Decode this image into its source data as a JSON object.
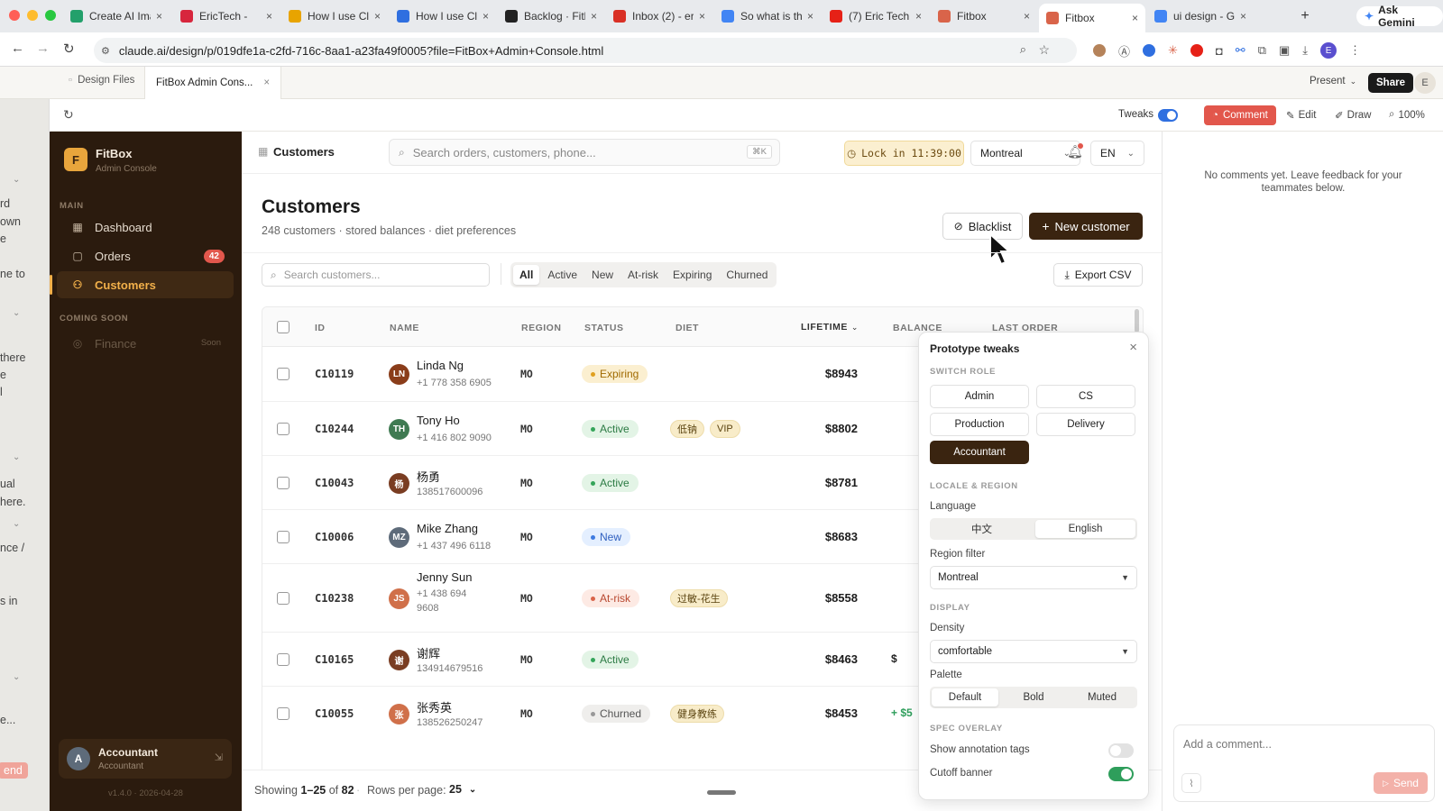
{
  "browser": {
    "tabs": [
      {
        "label": "Create AI Ima",
        "fav": "#23a06b"
      },
      {
        "label": "EricTech - ",
        "fav": "#d7263d"
      },
      {
        "label": "How I use Cla",
        "fav": "#e8a400"
      },
      {
        "label": "How I use Cla",
        "fav": "#2f6fe0"
      },
      {
        "label": "Backlog · Fith",
        "fav": "#222222"
      },
      {
        "label": "Inbox (2) - er",
        "fav": "#d93025"
      },
      {
        "label": "So what is thi",
        "fav": "#4285f4"
      },
      {
        "label": "(7) Eric Tech",
        "fav": "#e62117"
      },
      {
        "label": "Fitbox",
        "fav": "#d9644a"
      },
      {
        "label": "Fitbox",
        "fav": "#d9644a"
      },
      {
        "label": "ui design - G",
        "fav": "#4285f4"
      }
    ],
    "gemini": "Ask Gemini",
    "url": "claude.ai/design/p/019dfe1a-c2fd-716c-8aa1-a23fa49f0005?file=FitBox+Admin+Console.html",
    "profile_initial": "E"
  },
  "appbar": {
    "tab1": "Design Files",
    "tab2": "FitBox Admin Cons...",
    "present": "Present",
    "share": "Share",
    "avatar": "E"
  },
  "toolbar": {
    "tweaks": "Tweaks",
    "comment": "Comment",
    "edit": "Edit",
    "draw": "Draw",
    "zoom": "100%"
  },
  "leftstrip": [
    "rd",
    "own",
    "e",
    "ne to",
    "there",
    "e",
    "l",
    "ual",
    "here.",
    "nce /",
    "s in",
    "e...",
    "end"
  ],
  "sidebar": {
    "logo": "F",
    "brand": "FitBox",
    "brand_sub": "Admin Console",
    "section_main": "MAIN",
    "items": [
      {
        "label": "Dashboard",
        "icon": "grid-icon"
      },
      {
        "label": "Orders",
        "icon": "bag-icon",
        "badge": "42"
      },
      {
        "label": "Customers",
        "icon": "users-icon"
      }
    ],
    "section_soon": "COMING SOON",
    "finance": "Finance",
    "finance_badge": "Soon",
    "user_initial": "A",
    "user_name": "Accountant",
    "user_role": "Accountant",
    "version": "v1.4.0 · 2026-04-28"
  },
  "header": {
    "crumb": "Customers",
    "search_placeholder": "Search orders, customers, phone...",
    "shortcut": "⌘K",
    "lock": "Lock in 11:39:00",
    "city": "Montreal",
    "lang": "EN"
  },
  "page": {
    "title": "Customers",
    "subtitle": "248 customers · stored balances · diet preferences",
    "blacklist": "Blacklist",
    "new_customer": "New customer",
    "search_placeholder": "Search customers...",
    "filters": [
      "All",
      "Active",
      "New",
      "At-risk",
      "Expiring",
      "Churned"
    ],
    "export": "Export CSV"
  },
  "table": {
    "headers": {
      "id": "ID",
      "name": "NAME",
      "region": "REGION",
      "status": "STATUS",
      "diet": "DIET",
      "lifetime": "LIFETIME",
      "balance": "BALANCE",
      "last_order": "LAST ORDER"
    },
    "rows": [
      {
        "id": "C10119",
        "initials": "LN",
        "color": "#8a3d1a",
        "name": "Linda Ng",
        "phone": "+1 778 358 6905",
        "region": "MO",
        "status": "Expiring",
        "diet": [],
        "lifetime": "$8943",
        "balance": ""
      },
      {
        "id": "C10244",
        "initials": "TH",
        "color": "#3f7a52",
        "name": "Tony Ho",
        "phone": "+1 416 802 9090",
        "region": "MO",
        "status": "Active",
        "diet": [
          "低钠",
          "VIP"
        ],
        "lifetime": "$8802",
        "balance": ""
      },
      {
        "id": "C10043",
        "initials": "杨",
        "color": "#7a3d22",
        "name": "杨勇",
        "phone": "138517600096",
        "region": "MO",
        "status": "Active",
        "diet": [],
        "lifetime": "$8781",
        "balance": ""
      },
      {
        "id": "C10006",
        "initials": "MZ",
        "color": "#5e6b7a",
        "name": "Mike Zhang",
        "phone": "+1 437 496 6118",
        "region": "MO",
        "status": "New",
        "diet": [],
        "lifetime": "$8683",
        "balance": ""
      },
      {
        "id": "C10238",
        "initials": "JS",
        "color": "#d0704a",
        "name": "Jenny Sun",
        "phone": "+1 438 694 9608",
        "region": "MO",
        "status": "At-risk",
        "diet": [
          "过敏-花生"
        ],
        "lifetime": "$8558",
        "balance": ""
      },
      {
        "id": "C10165",
        "initials": "谢",
        "color": "#7a3d22",
        "name": "谢辉",
        "phone": "134914679516",
        "region": "MO",
        "status": "Active",
        "diet": [],
        "lifetime": "$8463",
        "balance": "$"
      },
      {
        "id": "C10055",
        "initials": "张",
        "color": "#d0704a",
        "name": "张秀英",
        "phone": "138526250247",
        "region": "MO",
        "status": "Churned",
        "diet": [
          "健身教练"
        ],
        "lifetime": "$8453",
        "balance": "+ $5"
      }
    ]
  },
  "footer": {
    "showing": "Showing",
    "range": "1–25",
    "of": "of",
    "total": "82",
    "rows_per_page": "Rows per page:",
    "per_page": "25"
  },
  "comments": {
    "empty": "No comments yet. Leave feedback for your teammates below.",
    "placeholder": "Add a comment...",
    "send": "Send"
  },
  "tweaks": {
    "title": "Prototype tweaks",
    "switch_role": "SWITCH ROLE",
    "roles": [
      "Admin",
      "CS",
      "Production",
      "Delivery",
      "Accountant"
    ],
    "locale": "LOCALE & REGION",
    "language": "Language",
    "lang_zh": "中文",
    "lang_en": "English",
    "region_filter": "Region filter",
    "region_value": "Montreal",
    "display": "DISPLAY",
    "density": "Density",
    "density_value": "comfortable",
    "palette": "Palette",
    "palettes": [
      "Default",
      "Bold",
      "Muted"
    ],
    "spec": "SPEC OVERLAY",
    "annotation": "Show annotation tags",
    "annotation_on": false,
    "cutoff": "Cutoff banner",
    "cutoff_on": true
  },
  "colors": {
    "brand_dark": "#3a2410",
    "accent": "#e2574c",
    "toggle_on": "#2e9e5b",
    "tweaks_blue": "#2f6fe0"
  }
}
